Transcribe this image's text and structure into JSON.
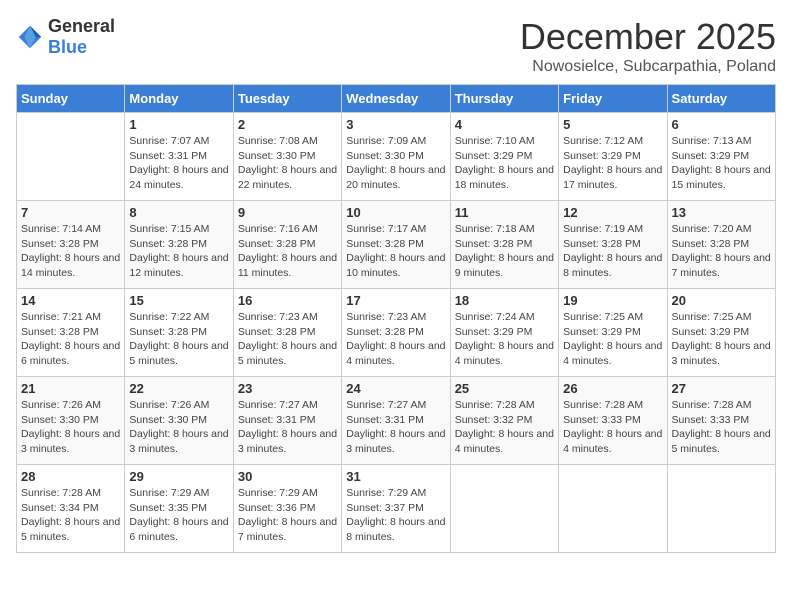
{
  "header": {
    "logo_general": "General",
    "logo_blue": "Blue",
    "month_title": "December 2025",
    "location": "Nowosielce, Subcarpathia, Poland"
  },
  "weekdays": [
    "Sunday",
    "Monday",
    "Tuesday",
    "Wednesday",
    "Thursday",
    "Friday",
    "Saturday"
  ],
  "weeks": [
    [
      {
        "day": "",
        "sunrise": "",
        "sunset": "",
        "daylight": ""
      },
      {
        "day": "1",
        "sunrise": "Sunrise: 7:07 AM",
        "sunset": "Sunset: 3:31 PM",
        "daylight": "Daylight: 8 hours and 24 minutes."
      },
      {
        "day": "2",
        "sunrise": "Sunrise: 7:08 AM",
        "sunset": "Sunset: 3:30 PM",
        "daylight": "Daylight: 8 hours and 22 minutes."
      },
      {
        "day": "3",
        "sunrise": "Sunrise: 7:09 AM",
        "sunset": "Sunset: 3:30 PM",
        "daylight": "Daylight: 8 hours and 20 minutes."
      },
      {
        "day": "4",
        "sunrise": "Sunrise: 7:10 AM",
        "sunset": "Sunset: 3:29 PM",
        "daylight": "Daylight: 8 hours and 18 minutes."
      },
      {
        "day": "5",
        "sunrise": "Sunrise: 7:12 AM",
        "sunset": "Sunset: 3:29 PM",
        "daylight": "Daylight: 8 hours and 17 minutes."
      },
      {
        "day": "6",
        "sunrise": "Sunrise: 7:13 AM",
        "sunset": "Sunset: 3:29 PM",
        "daylight": "Daylight: 8 hours and 15 minutes."
      }
    ],
    [
      {
        "day": "7",
        "sunrise": "Sunrise: 7:14 AM",
        "sunset": "Sunset: 3:28 PM",
        "daylight": "Daylight: 8 hours and 14 minutes."
      },
      {
        "day": "8",
        "sunrise": "Sunrise: 7:15 AM",
        "sunset": "Sunset: 3:28 PM",
        "daylight": "Daylight: 8 hours and 12 minutes."
      },
      {
        "day": "9",
        "sunrise": "Sunrise: 7:16 AM",
        "sunset": "Sunset: 3:28 PM",
        "daylight": "Daylight: 8 hours and 11 minutes."
      },
      {
        "day": "10",
        "sunrise": "Sunrise: 7:17 AM",
        "sunset": "Sunset: 3:28 PM",
        "daylight": "Daylight: 8 hours and 10 minutes."
      },
      {
        "day": "11",
        "sunrise": "Sunrise: 7:18 AM",
        "sunset": "Sunset: 3:28 PM",
        "daylight": "Daylight: 8 hours and 9 minutes."
      },
      {
        "day": "12",
        "sunrise": "Sunrise: 7:19 AM",
        "sunset": "Sunset: 3:28 PM",
        "daylight": "Daylight: 8 hours and 8 minutes."
      },
      {
        "day": "13",
        "sunrise": "Sunrise: 7:20 AM",
        "sunset": "Sunset: 3:28 PM",
        "daylight": "Daylight: 8 hours and 7 minutes."
      }
    ],
    [
      {
        "day": "14",
        "sunrise": "Sunrise: 7:21 AM",
        "sunset": "Sunset: 3:28 PM",
        "daylight": "Daylight: 8 hours and 6 minutes."
      },
      {
        "day": "15",
        "sunrise": "Sunrise: 7:22 AM",
        "sunset": "Sunset: 3:28 PM",
        "daylight": "Daylight: 8 hours and 5 minutes."
      },
      {
        "day": "16",
        "sunrise": "Sunrise: 7:23 AM",
        "sunset": "Sunset: 3:28 PM",
        "daylight": "Daylight: 8 hours and 5 minutes."
      },
      {
        "day": "17",
        "sunrise": "Sunrise: 7:23 AM",
        "sunset": "Sunset: 3:28 PM",
        "daylight": "Daylight: 8 hours and 4 minutes."
      },
      {
        "day": "18",
        "sunrise": "Sunrise: 7:24 AM",
        "sunset": "Sunset: 3:29 PM",
        "daylight": "Daylight: 8 hours and 4 minutes."
      },
      {
        "day": "19",
        "sunrise": "Sunrise: 7:25 AM",
        "sunset": "Sunset: 3:29 PM",
        "daylight": "Daylight: 8 hours and 4 minutes."
      },
      {
        "day": "20",
        "sunrise": "Sunrise: 7:25 AM",
        "sunset": "Sunset: 3:29 PM",
        "daylight": "Daylight: 8 hours and 3 minutes."
      }
    ],
    [
      {
        "day": "21",
        "sunrise": "Sunrise: 7:26 AM",
        "sunset": "Sunset: 3:30 PM",
        "daylight": "Daylight: 8 hours and 3 minutes."
      },
      {
        "day": "22",
        "sunrise": "Sunrise: 7:26 AM",
        "sunset": "Sunset: 3:30 PM",
        "daylight": "Daylight: 8 hours and 3 minutes."
      },
      {
        "day": "23",
        "sunrise": "Sunrise: 7:27 AM",
        "sunset": "Sunset: 3:31 PM",
        "daylight": "Daylight: 8 hours and 3 minutes."
      },
      {
        "day": "24",
        "sunrise": "Sunrise: 7:27 AM",
        "sunset": "Sunset: 3:31 PM",
        "daylight": "Daylight: 8 hours and 3 minutes."
      },
      {
        "day": "25",
        "sunrise": "Sunrise: 7:28 AM",
        "sunset": "Sunset: 3:32 PM",
        "daylight": "Daylight: 8 hours and 4 minutes."
      },
      {
        "day": "26",
        "sunrise": "Sunrise: 7:28 AM",
        "sunset": "Sunset: 3:33 PM",
        "daylight": "Daylight: 8 hours and 4 minutes."
      },
      {
        "day": "27",
        "sunrise": "Sunrise: 7:28 AM",
        "sunset": "Sunset: 3:33 PM",
        "daylight": "Daylight: 8 hours and 5 minutes."
      }
    ],
    [
      {
        "day": "28",
        "sunrise": "Sunrise: 7:28 AM",
        "sunset": "Sunset: 3:34 PM",
        "daylight": "Daylight: 8 hours and 5 minutes."
      },
      {
        "day": "29",
        "sunrise": "Sunrise: 7:29 AM",
        "sunset": "Sunset: 3:35 PM",
        "daylight": "Daylight: 8 hours and 6 minutes."
      },
      {
        "day": "30",
        "sunrise": "Sunrise: 7:29 AM",
        "sunset": "Sunset: 3:36 PM",
        "daylight": "Daylight: 8 hours and 7 minutes."
      },
      {
        "day": "31",
        "sunrise": "Sunrise: 7:29 AM",
        "sunset": "Sunset: 3:37 PM",
        "daylight": "Daylight: 8 hours and 8 minutes."
      },
      {
        "day": "",
        "sunrise": "",
        "sunset": "",
        "daylight": ""
      },
      {
        "day": "",
        "sunrise": "",
        "sunset": "",
        "daylight": ""
      },
      {
        "day": "",
        "sunrise": "",
        "sunset": "",
        "daylight": ""
      }
    ]
  ]
}
